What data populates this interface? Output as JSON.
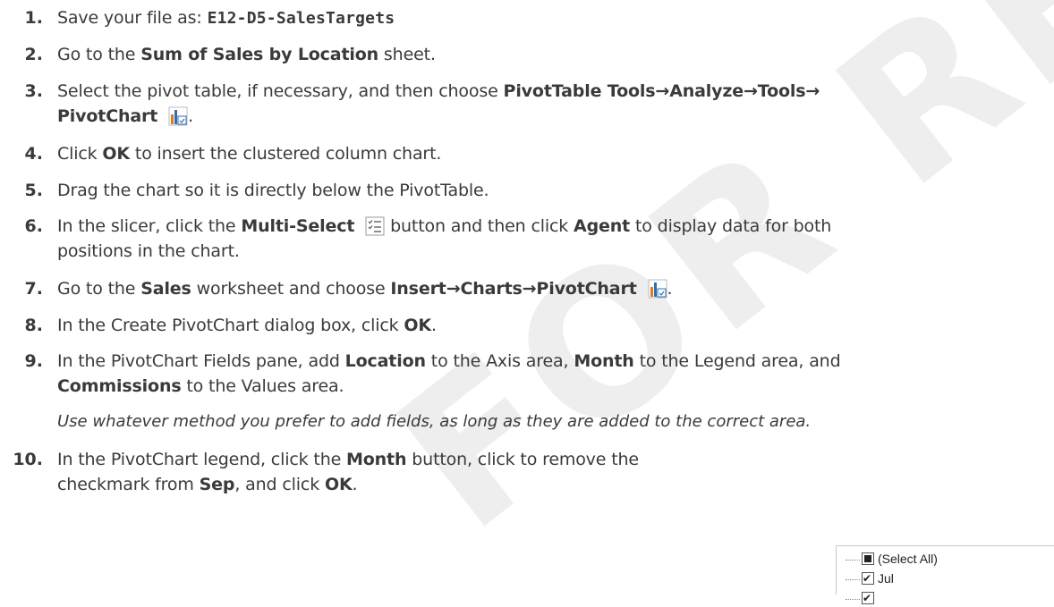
{
  "watermark": "FOR REVIEW ONLY",
  "steps": [
    {
      "num": "1.",
      "text1": "Save your file as: ",
      "code": "E12-D5-SalesTargets"
    },
    {
      "num": "2.",
      "text1": "Go to the ",
      "bold1": "Sum of Sales by Location",
      "text2": " sheet."
    },
    {
      "num": "3.",
      "text1": "Select the pivot table, if necessary, and then choose ",
      "bold1": "PivotTable Tools→Analyze→Tools→",
      "bold2": "PivotChart",
      "text2": "."
    },
    {
      "num": "4.",
      "text1": "Click ",
      "bold1": "OK",
      "text2": " to insert the clustered column chart."
    },
    {
      "num": "5.",
      "text1": "Drag the chart so it is directly below the PivotTable."
    },
    {
      "num": "6.",
      "text1": "In the slicer, click the ",
      "bold1": "Multi-Select",
      "text2": " button and then click ",
      "bold2": "Agent",
      "text3": " to display data for both",
      "line2": "positions in the chart."
    },
    {
      "num": "7.",
      "text1": "Go to the ",
      "bold1": "Sales",
      "text2": " worksheet and choose ",
      "bold2": "Insert→Charts→PivotChart",
      "text3": "."
    },
    {
      "num": "8.",
      "text1": "In the Create PivotChart dialog box, click ",
      "bold1": "OK",
      "text2": "."
    },
    {
      "num": "9.",
      "text1": "In the PivotChart Fields pane, add ",
      "bold1": "Location",
      "text2": " to the Axis area, ",
      "bold2": "Month",
      "text3": " to the Legend area, and",
      "bold3": "Commissions",
      "text4": " to the Values area.",
      "note": "Use whatever method you prefer to add fields, as long as they are added to the correct area."
    },
    {
      "num": "10.",
      "text1": "In the PivotChart legend, click the ",
      "bold1": "Month",
      "text2": " button, click to remove the",
      "text3": "checkmark from ",
      "bold2": "Sep",
      "text4": ", and click ",
      "bold3": "OK",
      "text5": "."
    }
  ],
  "filter_list": {
    "items": [
      {
        "label": "(Select All)",
        "state": "partial"
      },
      {
        "label": "Jul",
        "state": "checked"
      }
    ]
  }
}
